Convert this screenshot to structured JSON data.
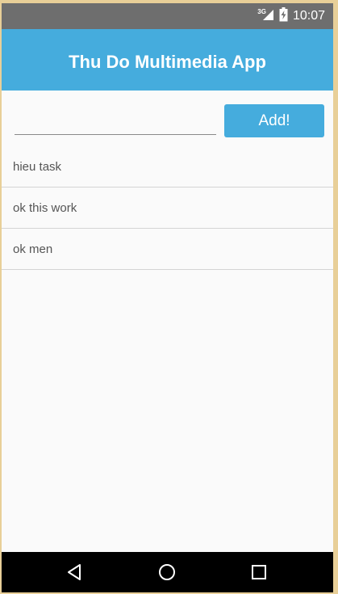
{
  "status_bar": {
    "network": "3G",
    "time": "10:07",
    "icons": [
      "signal-icon",
      "battery-icon"
    ]
  },
  "app_bar": {
    "title": "Thu Do Multimedia App"
  },
  "task_input": {
    "value": "",
    "placeholder": ""
  },
  "add_button": {
    "label": "Add!"
  },
  "tasks": [
    {
      "label": "hieu task"
    },
    {
      "label": "ok this work"
    },
    {
      "label": "ok men"
    }
  ],
  "nav_bar": {
    "icons": [
      "back-icon",
      "home-icon",
      "recents-icon"
    ]
  },
  "colors": {
    "accent": "#45acdd",
    "status_bar": "#6e6e6e",
    "nav_bar": "#000000",
    "background": "#fafafa"
  }
}
